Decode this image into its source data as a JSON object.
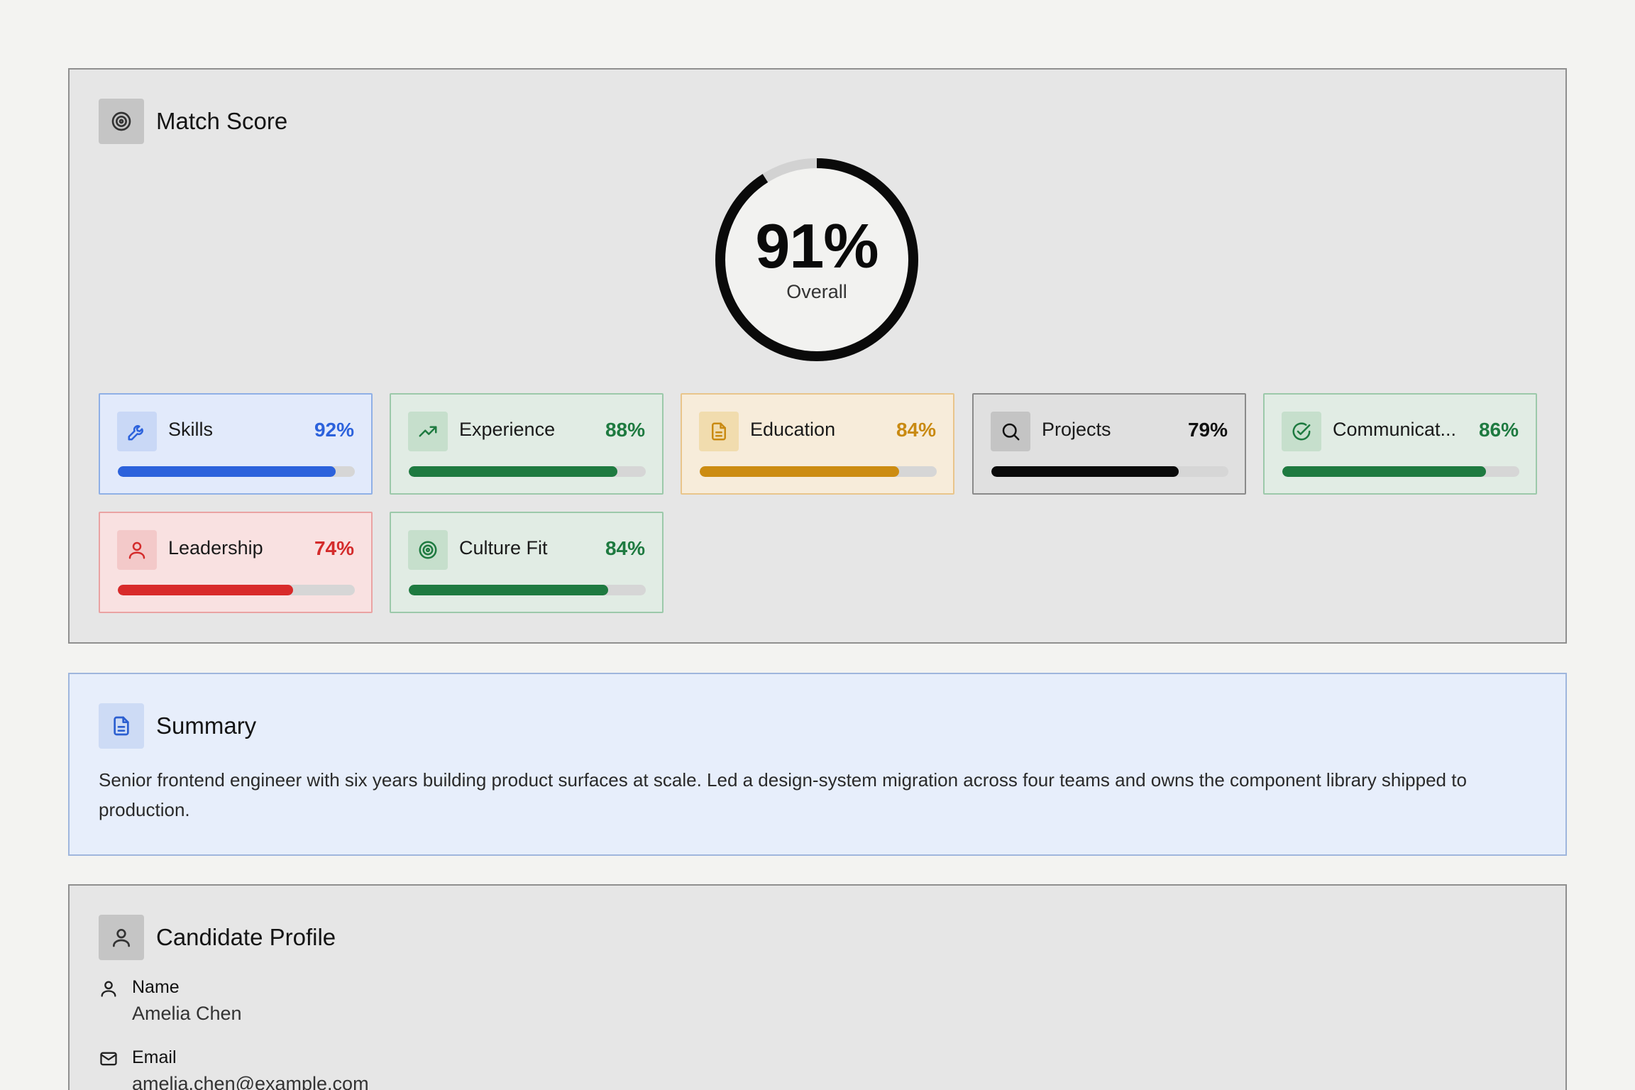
{
  "match_score": {
    "title": "Match Score",
    "overall_value": "91%",
    "overall_fraction": 0.91,
    "overall_label": "Overall",
    "metrics": [
      {
        "label": "Skills",
        "value": "92%",
        "fraction": 0.92,
        "icon": "wrench-icon",
        "color": "#2c62dc"
      },
      {
        "label": "Experience",
        "value": "88%",
        "fraction": 0.88,
        "icon": "trending-up-icon",
        "color": "#1e7a40"
      },
      {
        "label": "Education",
        "value": "84%",
        "fraction": 0.84,
        "icon": "document-icon",
        "color": "#cc8c12"
      },
      {
        "label": "Projects",
        "value": "79%",
        "fraction": 0.79,
        "icon": "search-icon",
        "color": "#0a0a0a"
      },
      {
        "label": "Communicat...",
        "value": "86%",
        "fraction": 0.86,
        "icon": "check-circle-icon",
        "color": "#1e7a40"
      },
      {
        "label": "Leadership",
        "value": "74%",
        "fraction": 0.74,
        "icon": "user-icon",
        "color": "#d82a2a"
      },
      {
        "label": "Culture Fit",
        "value": "84%",
        "fraction": 0.84,
        "icon": "target-icon",
        "color": "#1e7a40"
      }
    ]
  },
  "summary": {
    "title": "Summary",
    "text": "Senior frontend engineer with six years building product surfaces at scale. Led a design-system migration across four teams and owns the component library shipped to production."
  },
  "candidate_profile": {
    "title": "Candidate Profile",
    "fields": [
      {
        "label": "Name",
        "value": "Amelia Chen",
        "icon": "user-icon"
      },
      {
        "label": "Email",
        "value": "amelia.chen@example.com",
        "icon": "mail-icon"
      }
    ]
  }
}
